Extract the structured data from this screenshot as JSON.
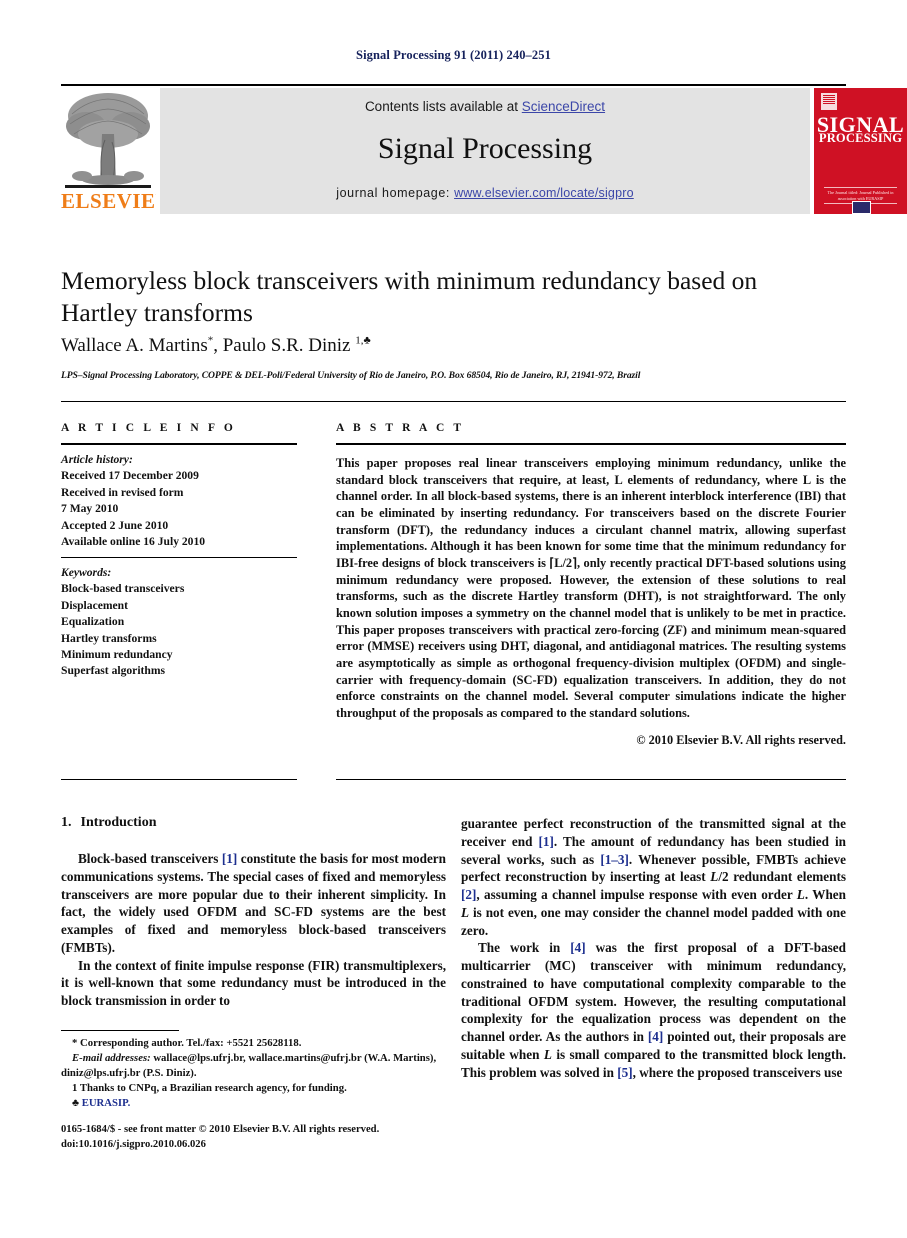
{
  "running_head": "Signal Processing 91 (2011) 240–251",
  "masthead": {
    "contents_prefix": "Contents lists available at ",
    "sciencedirect": "ScienceDirect",
    "journal_name": "Signal Processing",
    "homepage_prefix": "journal homepage: ",
    "homepage_url": "www.elsevier.com/locate/sigpro",
    "publisher_wordmark": "ELSEVIER",
    "cover": {
      "line1": "SIGNAL",
      "line2": "PROCESSING",
      "subtitle": "The Journal titled: Journal\nPublished in association with EURASIP"
    },
    "colors": {
      "link": "#3b46a8",
      "elsevier_orange": "#ef7d18",
      "cover_red": "#cf1124",
      "running_head": "#16225c"
    }
  },
  "article": {
    "title": "Memoryless block transceivers with minimum redundancy based on Hartley transforms",
    "authors_html": "Wallace A. Martins *, Paulo S.R. Diniz 1,♣",
    "affiliation": "LPS–Signal Processing Laboratory, COPPE & DEL-Poli/Federal University of Rio de Janeiro, P.O. Box 68504, Rio de Janeiro, RJ, 21941-972, Brazil"
  },
  "article_info": {
    "heading": "A R T I C L E   I N F O",
    "history_label": "Article history:",
    "history": [
      "Received 17 December 2009",
      "Received in revised form",
      "7 May 2010",
      "Accepted 2 June 2010",
      "Available online 16 July 2010"
    ],
    "keywords_label": "Keywords:",
    "keywords": [
      "Block-based transceivers",
      "Displacement",
      "Equalization",
      "Hartley transforms",
      "Minimum redundancy",
      "Superfast algorithms"
    ]
  },
  "abstract": {
    "heading": "A B S T R A C T",
    "text": "This paper proposes real linear transceivers employing minimum redundancy, unlike the standard block transceivers that require, at least, L elements of redundancy, where L is the channel order. In all block-based systems, there is an inherent interblock interference (IBI) that can be eliminated by inserting redundancy. For transceivers based on the discrete Fourier transform (DFT), the redundancy induces a circulant channel matrix, allowing superfast implementations. Although it has been known for some time that the minimum redundancy for IBI-free designs of block transceivers is ⌈L/2⌉, only recently practical DFT-based solutions using minimum redundancy were proposed. However, the extension of these solutions to real transforms, such as the discrete Hartley transform (DHT), is not straightforward. The only known solution imposes a symmetry on the channel model that is unlikely to be met in practice. This paper proposes transceivers with practical zero-forcing (ZF) and minimum mean-squared error (MMSE) receivers using DHT, diagonal, and antidiagonal matrices. The resulting systems are asymptotically as simple as orthogonal frequency-division multiplex (OFDM) and single-carrier with frequency-domain (SC-FD) equalization transceivers. In addition, they do not enforce constraints on the channel model. Several computer simulations indicate the higher throughput of the proposals as compared to the standard solutions.",
    "copyright": "© 2010 Elsevier B.V. All rights reserved."
  },
  "body": {
    "section_number": "1.",
    "section_title": "Introduction",
    "left_paragraphs": [
      "Block-based transceivers [1] constitute the basis for most modern communications systems. The special cases of fixed and memoryless transceivers are more popular due to their inherent simplicity. In fact, the widely used OFDM and SC-FD systems are the best examples of fixed and memoryless block-based transceivers (FMBTs).",
      "In the context of finite impulse response (FIR) transmultiplexers, it is well-known that some redundancy must be introduced in the block transmission in order to"
    ],
    "right_paragraphs": [
      "guarantee perfect reconstruction of the transmitted signal at the receiver end [1]. The amount of redundancy has been studied in several works, such as [1–3]. Whenever possible, FMBTs achieve perfect reconstruction by inserting at least L/2 redundant elements [2], assuming a channel impulse response with even order L. When L is not even, one may consider the channel model padded with one zero.",
      "The work in [4] was the first proposal of a DFT-based multicarrier (MC) transceiver with minimum redundancy, constrained to have computational complexity comparable to the traditional OFDM system. However, the resulting computational complexity for the equalization process was dependent on the channel order. As the authors in [4] pointed out, their proposals are suitable when L is small compared to the transmitted block length. This problem was solved in [5], where the proposed transceivers use"
    ]
  },
  "footnotes": {
    "corresponding": "* Corresponding author. Tel./fax: +5521 25628118.",
    "email_label": "E-mail addresses:",
    "emails": " wallace@lps.ufrj.br, wallace.martins@ufrj.br (W.A. Martins), diniz@lps.ufrj.br (P.S. Diniz).",
    "note1": "1 Thanks to CNPq, a Brazilian research agency, for funding.",
    "note2_symbol": "♣",
    "note2": "EURASIP."
  },
  "imprint": {
    "line1": "0165-1684/$ - see front matter © 2010 Elsevier B.V. All rights reserved.",
    "line2": "doi:10.1016/j.sigpro.2010.06.026"
  }
}
